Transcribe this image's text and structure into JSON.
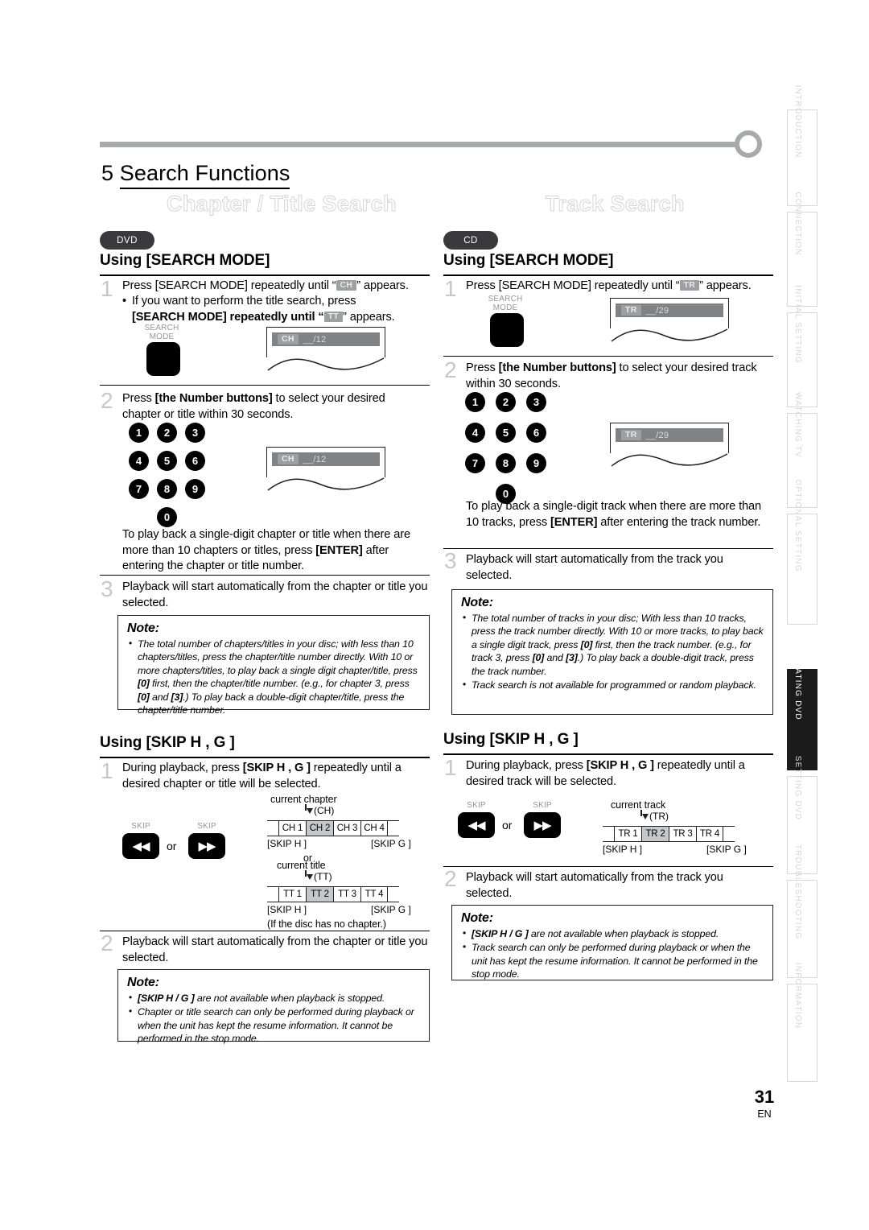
{
  "page": {
    "chapter_number": "5",
    "chapter_title": "Search Functions",
    "number": "31",
    "language": "EN"
  },
  "sections": {
    "left": {
      "ghost_title": "Chapter / Title Search",
      "badge": "DVD",
      "heading_search_mode": "Using [SEARCH MODE]",
      "step1": {
        "num": "1",
        "text_a": "Press [SEARCH MODE] repeatedly until “",
        "chip": "CH",
        "text_b": "” appears.",
        "bullet_a": "If you want to perform the title search, press",
        "bullet_b": "[SEARCH MODE] repeatedly until “",
        "bullet_chip": "TT",
        "bullet_c": "” appears.",
        "button_label": "SEARCH\nMODE",
        "panel_chip": "CH",
        "panel_value": "__/12"
      },
      "step2": {
        "num": "2",
        "text": "Press [the Number buttons] to select your desired chapter or title within 30 seconds.",
        "keys": [
          "1",
          "2",
          "3",
          "4",
          "5",
          "6",
          "7",
          "8",
          "9",
          "0"
        ],
        "panel_chip": "CH",
        "panel_value": "__/12",
        "trailing": "To play back a single-digit chapter or title when there are more than 10 chapters or titles, press [ENTER] after entering the chapter or title number."
      },
      "step3": {
        "num": "3",
        "text": "Playback will start automatically from the chapter or title you selected."
      },
      "note1": {
        "title": "Note:",
        "items": [
          "The total number of chapters/titles in your disc; with less than 10 chapters/titles, press the chapter/title number directly. With 10 or more chapters/titles, to play back a single digit chapter/title, press [0] first, then the chapter/title number. (e.g., for chapter 3, press [0] and [3].) To play back a double-digit chapter/title, press the chapter/title number."
        ]
      },
      "heading_skip": "Using [SKIP H , G ]",
      "skip_step1": {
        "num": "1",
        "text": "During playback, press [SKIP H , G ] repeatedly until a desired chapter or title will be selected."
      },
      "skip_buttons": {
        "label_left": "SKIP",
        "label_right": "SKIP",
        "glyph_left": "◀◀",
        "glyph_right": "▶▶",
        "or": "or"
      },
      "strip_chapter": {
        "caption": "current chapter",
        "marker": "(CH)",
        "cells": [
          "CH 1",
          "CH 2",
          "CH 3",
          "CH 4"
        ],
        "highlight_index": 1,
        "skip_left": "[SKIP H ]",
        "skip_right": "[SKIP G ]"
      },
      "strip_or": "or",
      "strip_title": {
        "caption": "current title",
        "marker": "(TT)",
        "cells": [
          "TT 1",
          "TT 2",
          "TT 3",
          "TT 4"
        ],
        "highlight_index": 1,
        "skip_left": "[SKIP H ]",
        "skip_right": "[SKIP G ]",
        "subnote": "(If the disc has no chapter.)"
      },
      "skip_step2": {
        "num": "2",
        "text": "Playback will start automatically from the chapter or title you selected."
      },
      "note2": {
        "title": "Note:",
        "items": [
          "[SKIP H / G ] are not available when playback is stopped.",
          "Chapter or title search can only be performed during playback or when the unit has kept the resume information. It cannot be performed in the stop mode."
        ]
      }
    },
    "right": {
      "ghost_title": "Track Search",
      "badge": "CD",
      "heading_search_mode": "Using [SEARCH MODE]",
      "step1": {
        "num": "1",
        "text_a": "Press [SEARCH MODE] repeatedly until “",
        "chip": "TR",
        "text_b": "” appears.",
        "button_label": "SEARCH\nMODE",
        "panel_chip": "TR",
        "panel_value": "__/29"
      },
      "step2": {
        "num": "2",
        "text": "Press [the Number buttons] to select your desired track within 30 seconds.",
        "keys": [
          "1",
          "2",
          "3",
          "4",
          "5",
          "6",
          "7",
          "8",
          "9",
          "0"
        ],
        "panel_chip": "TR",
        "panel_value": "__/29",
        "trailing": "To play back a single-digit track when there are more than 10 tracks, press [ENTER] after entering the track number."
      },
      "step3": {
        "num": "3",
        "text": "Playback will start automatically from the track you selected."
      },
      "note1": {
        "title": "Note:",
        "items": [
          "The total number of tracks in your disc; With less than 10 tracks, press the track number directly. With 10 or more tracks, to play back a single digit track, press [0] first, then the track number. (e.g., for track 3, press [0] and [3].) To play back a double-digit track, press the track number.",
          "Track search is not available for programmed or random playback."
        ]
      },
      "heading_skip": "Using [SKIP H , G ]",
      "skip_step1": {
        "num": "1",
        "text": "During playback, press [SKIP H , G ] repeatedly until a desired track will be selected."
      },
      "skip_buttons": {
        "label_left": "SKIP",
        "label_right": "SKIP",
        "glyph_left": "◀◀",
        "glyph_right": "▶▶",
        "or": "or"
      },
      "strip_track": {
        "caption": "current track",
        "marker": "(TR)",
        "cells": [
          "TR 1",
          "TR 2",
          "TR 3",
          "TR 4"
        ],
        "highlight_index": 1,
        "skip_left": "[SKIP H ]",
        "skip_right": "[SKIP G ]"
      },
      "skip_step2": {
        "num": "2",
        "text": "Playback will start automatically from the track you selected."
      },
      "note2": {
        "title": "Note:",
        "items": [
          "[SKIP H / G ] are not available when playback is stopped.",
          "Track search can only be performed during playback or when the unit has kept the resume information. It cannot be performed in the stop mode."
        ]
      }
    }
  },
  "side_tabs": [
    {
      "label": "INTRODUCTION",
      "active": false
    },
    {
      "label": "CONNECTION",
      "active": false
    },
    {
      "label": "INITIAL  SETTING",
      "active": false
    },
    {
      "label": "WATCHING  TV",
      "active": false
    },
    {
      "label": "OPTIONAL  SETTING",
      "active": false
    },
    {
      "label": "OPERATING  DVD",
      "active": true
    },
    {
      "label": "SETTING  DVD",
      "active": false
    },
    {
      "label": "TROUBLESHOOTING",
      "active": false
    },
    {
      "label": "INFORMATION",
      "active": false
    }
  ],
  "colors": {
    "rule": "#a7a9ac",
    "ghost_stroke": "#d4d5d7",
    "badge_bg": "#3a3a3c",
    "stepnum": "#c6c7c9",
    "osd_bar": "#808285",
    "chip_bg": "#9d9fa2",
    "tab_inactive_text": "#d5d6d8",
    "tab_active_bg": "#1b1b1b"
  }
}
